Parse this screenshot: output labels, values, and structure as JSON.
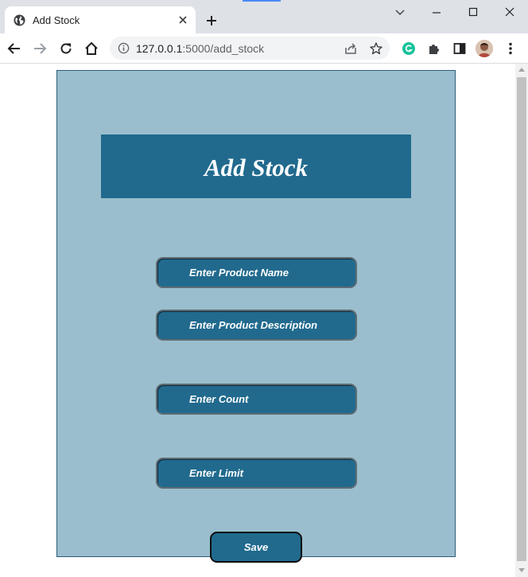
{
  "browser": {
    "tab": {
      "title": "Add Stock",
      "favicon": "globe-icon"
    },
    "address": {
      "host": "127.0.0.1",
      "port_path": ":5000/add_stock"
    },
    "colors": {
      "tabstrip": "#dee1e6",
      "omnibox": "#f1f3f4",
      "grammarly": "#15c39a"
    }
  },
  "page": {
    "title": "Add Stock",
    "fields": {
      "product_name": {
        "placeholder": "Enter Product Name",
        "value": ""
      },
      "product_description": {
        "placeholder": "Enter Product Description",
        "value": ""
      },
      "count": {
        "placeholder": "Enter Count",
        "value": ""
      },
      "limit": {
        "placeholder": "Enter Limit",
        "value": ""
      }
    },
    "save_label": "Save",
    "colors": {
      "panel": "#9abecd",
      "accent": "#216a8e",
      "text": "#ffffff"
    }
  }
}
